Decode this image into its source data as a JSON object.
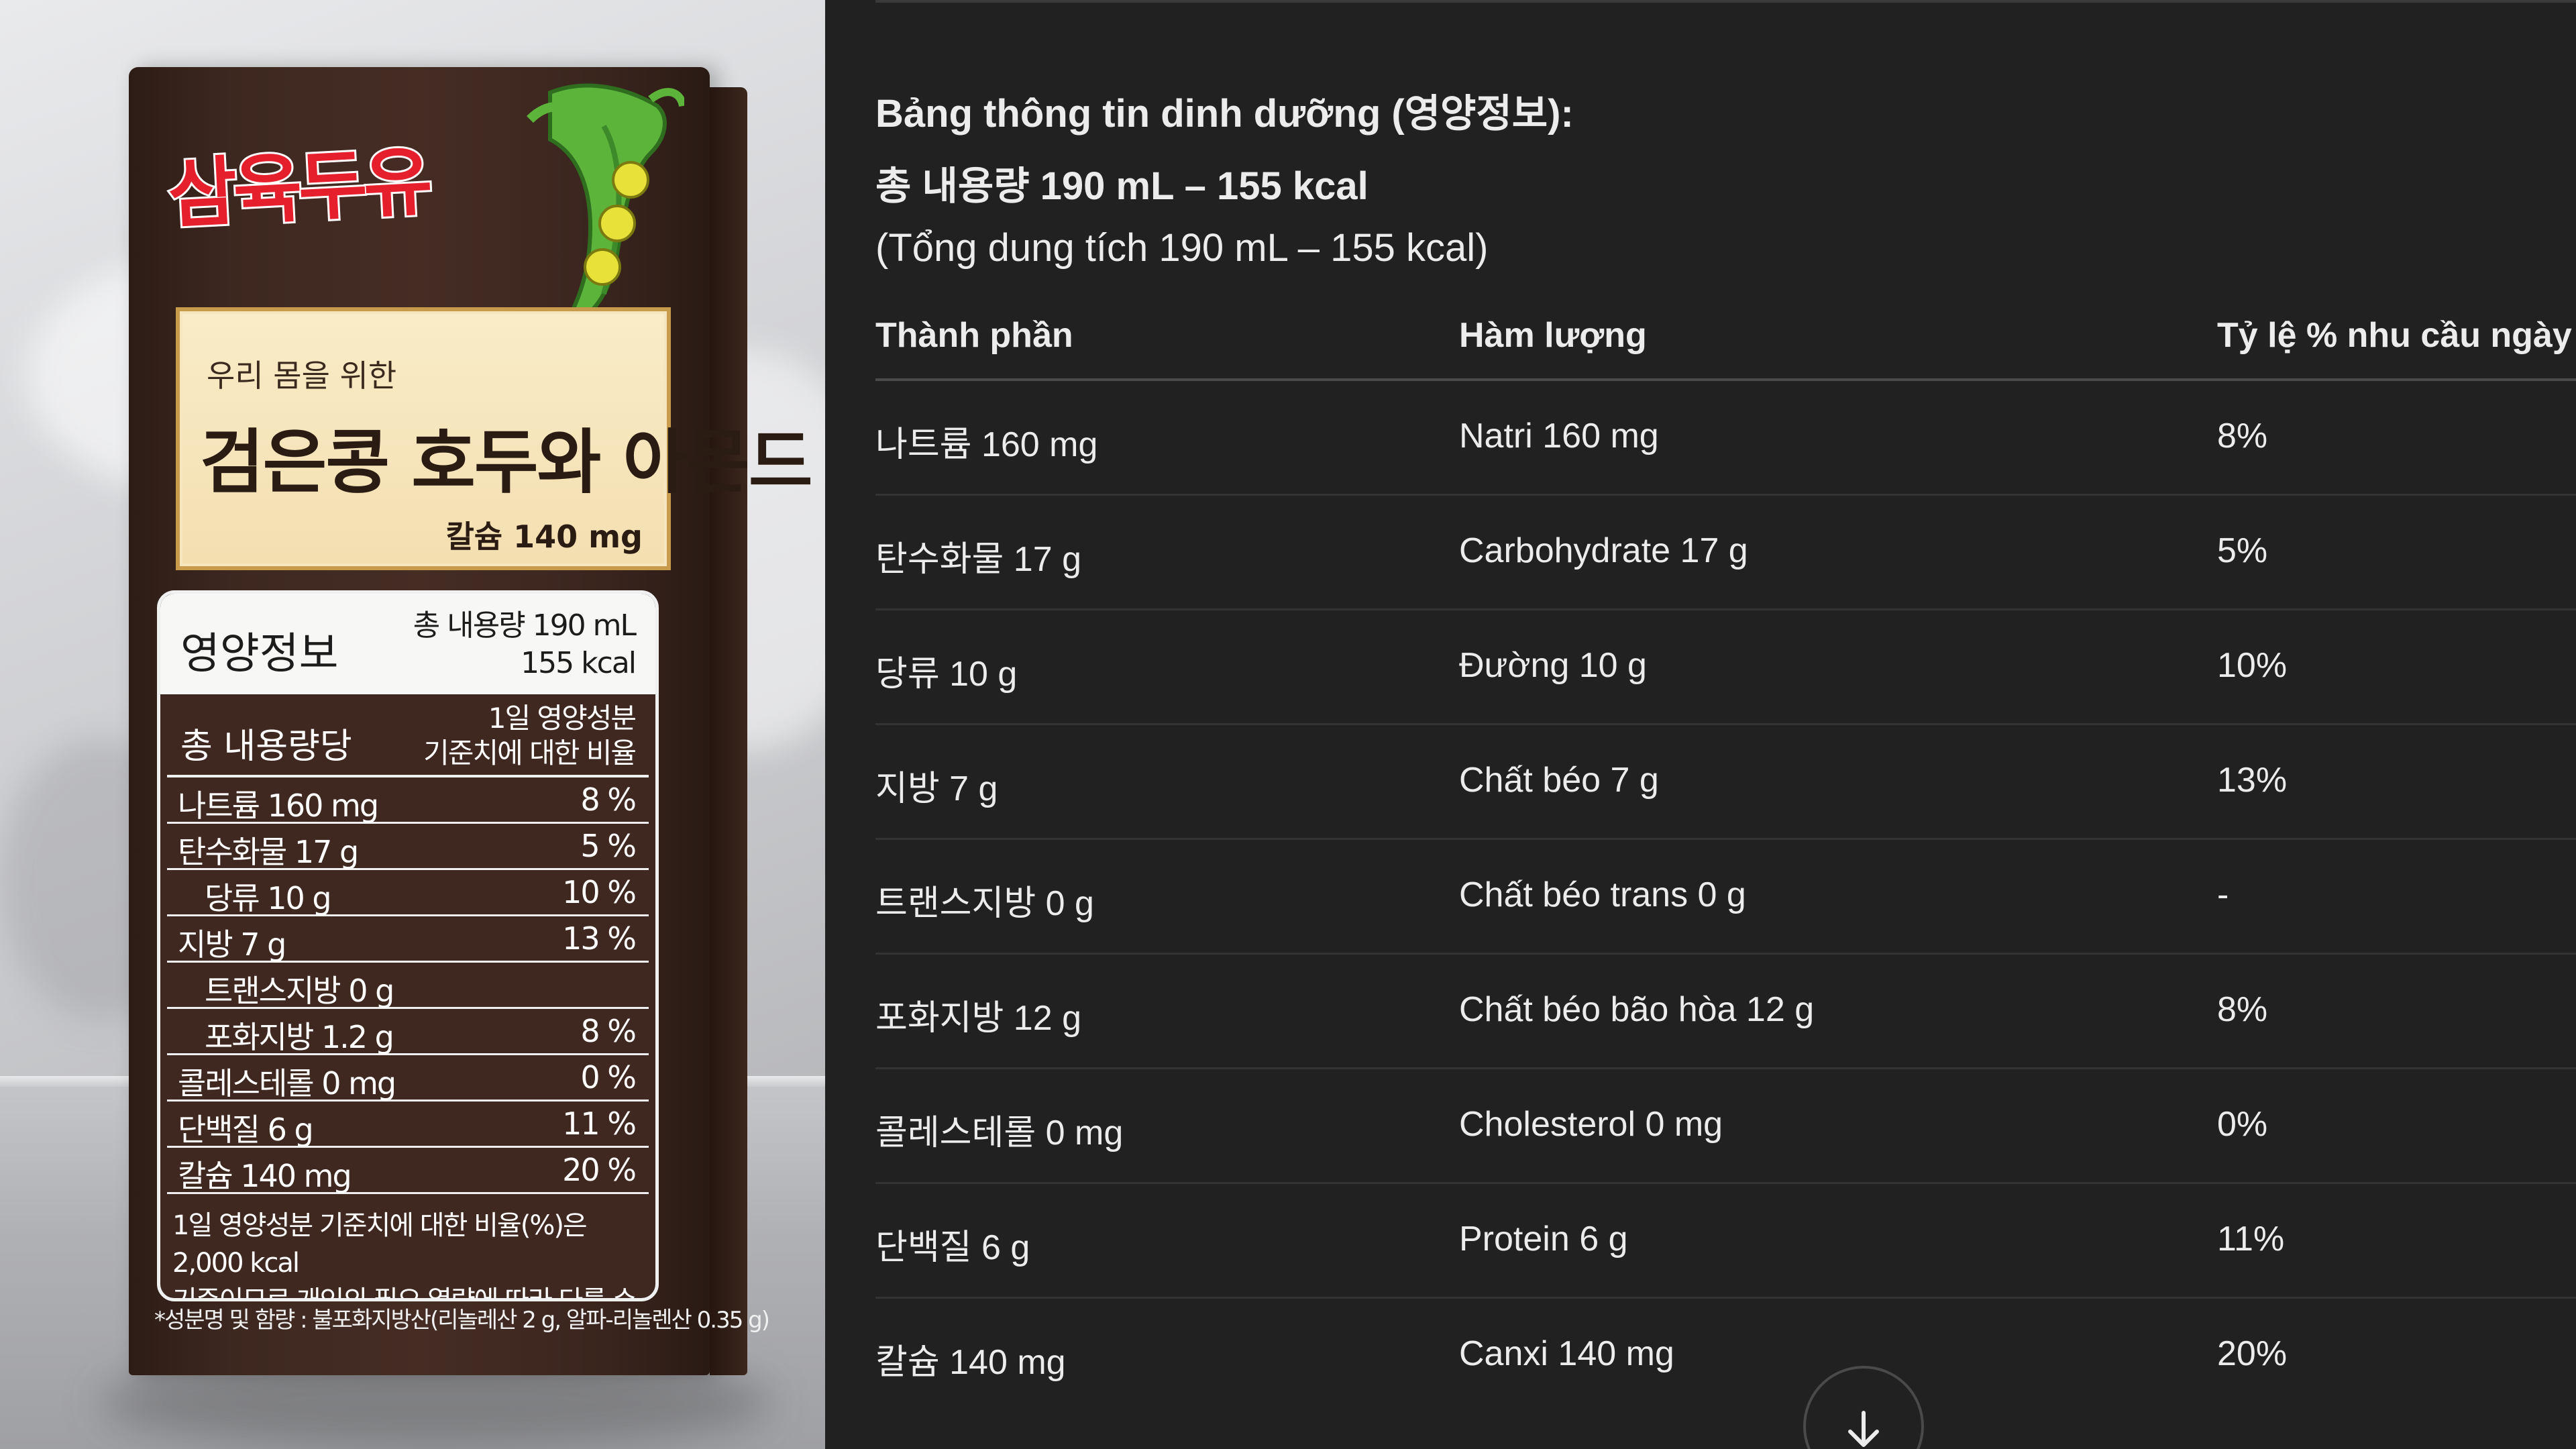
{
  "product_photo": {
    "brand": "삼육두유",
    "label_subtitle": "우리 몸을 위한",
    "label_title": "검은콩 호두와 아몬드",
    "label_calcium": "칼슘 140 mg",
    "nutrition_title": "영양정보",
    "nutrition_total_line1": "총 내용량 190 mL",
    "nutrition_total_line2": "155 kcal",
    "col_left": "총 내용량당",
    "col_right_line1": "1일 영양성분",
    "col_right_line2": "기준치에 대한 비율",
    "rows": [
      {
        "name": "나트륨 160 mg",
        "pct": "8 %",
        "sub": false
      },
      {
        "name": "탄수화물 17 g",
        "pct": "5 %",
        "sub": false
      },
      {
        "name": "당류 10 g",
        "pct": "10 %",
        "sub": true
      },
      {
        "name": "지방 7 g",
        "pct": "13 %",
        "sub": false
      },
      {
        "name": "트랜스지방 0 g",
        "pct": "",
        "sub": true
      },
      {
        "name": "포화지방 1.2 g",
        "pct": "8 %",
        "sub": true
      },
      {
        "name": "콜레스테롤 0 mg",
        "pct": "0 %",
        "sub": false
      },
      {
        "name": "단백질 6 g",
        "pct": "11 %",
        "sub": false
      },
      {
        "name": "칼슘 140 mg",
        "pct": "20 %",
        "sub": false
      }
    ],
    "footnote_line1": "1일 영양성분 기준치에 대한 비율(%)은 2,000 kcal",
    "footnote_line2": "기준이므로 개인의 필요 열량에 따라 다를 수 있습니다.",
    "ingredients": "*성분명 및 함량 : 불포화지방산(리놀레산 2 g, 알파-리놀렌산 0.35 g)"
  },
  "panel": {
    "heading": "Bảng thông tin dinh dưỡng (영양정보):",
    "subheading": "총 내용량 190 mL – 155 kcal",
    "subnote": "(Tổng dung tích 190 mL – 155 kcal)",
    "table": {
      "headers": [
        "Thành phần",
        "Hàm lượng",
        "Tỷ lệ % nhu cầu ngày"
      ],
      "rows": [
        [
          "나트륨 160 mg",
          "Natri 160 mg",
          "8%"
        ],
        [
          "탄수화물 17 g",
          "Carbohydrate 17 g",
          "5%"
        ],
        [
          "당류 10 g",
          "Đường 10 g",
          "10%"
        ],
        [
          "지방 7 g",
          "Chất béo 7 g",
          "13%"
        ],
        [
          "트랜스지방 0 g",
          "Chất béo trans 0 g",
          "-"
        ],
        [
          "포화지방 12 g",
          "Chất béo bão hòa 12 g",
          "8%"
        ],
        [
          "콜레스테롤 0 mg",
          "Cholesterol 0 mg",
          "0%"
        ],
        [
          "단백질 6 g",
          "Protein 6 g",
          "11%"
        ],
        [
          "칼슘 140 mg",
          "Canxi 140 mg",
          "20%"
        ]
      ]
    },
    "scroll_button_icon": "arrow-down-icon"
  },
  "colors": {
    "panel_bg": "#212121",
    "text": "#ececec",
    "brand_red": "#e5202c",
    "carton_brown": "#452d24"
  }
}
